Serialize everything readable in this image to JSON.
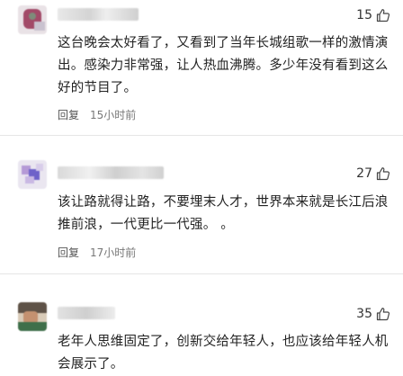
{
  "comments": [
    {
      "likes": "15",
      "text": "这台晚会太好看了，又看到了当年长城组歌一样的激情演出。感染力非常强，让人热血沸腾。多少年没有看到这么好的节目了。",
      "reply_label": "回复",
      "time": "15小时前"
    },
    {
      "likes": "27",
      "text": "该让路就得让路，不要埋末人才，世界本来就是长江后浪推前浪，一代更比一代强。 。",
      "reply_label": "回复",
      "time": "17小时前"
    },
    {
      "likes": "35",
      "text": "老年人思维固定了，创新交给年轻人，也应该给年轻人机会展示了。"
    }
  ],
  "icons": {
    "like": "thumbs-up-icon"
  },
  "colors": {
    "text": "#222222",
    "meta": "#777777",
    "divider": "#e6e6e6"
  }
}
